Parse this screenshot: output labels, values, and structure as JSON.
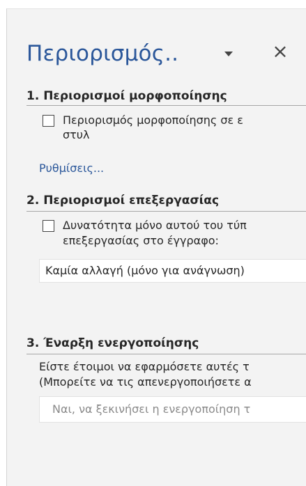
{
  "panel": {
    "title": "Περιορισμός..",
    "dropdown_icon": "triangle-down-icon",
    "close_label": "×"
  },
  "section1": {
    "heading": "1. Περιορισμοί μορφοποίησης",
    "checkbox_checked": false,
    "checkbox_label_line1": "Περιορισμός μορφοποίησης σε ε",
    "checkbox_label_line2": "στυλ",
    "settings_link": "Ρυθμίσεις..."
  },
  "section2": {
    "heading": "2. Περιορισμοί επεξεργασίας",
    "checkbox_checked": false,
    "checkbox_label_line1": "Δυνατότητα μόνο αυτού του τύπ",
    "checkbox_label_line2": "επεξεργασίας στο έγγραφο:",
    "select_value": "Καμία αλλαγή (μόνο για ανάγνωση)"
  },
  "section3": {
    "heading": "3. Έναρξη ενεργοποίησης",
    "description_line1": "Είστε έτοιμοι να εφαρμόσετε αυτές τ",
    "description_line2": "(Μπορείτε να τις απενεργοποιήσετε α",
    "start_button_label": "Ναι, να ξεκινήσει η ενεργοποίηση τ"
  },
  "colors": {
    "accent": "#2b579a",
    "panel_bg": "#f3f3f3",
    "disabled_text": "#8a8a8a"
  }
}
